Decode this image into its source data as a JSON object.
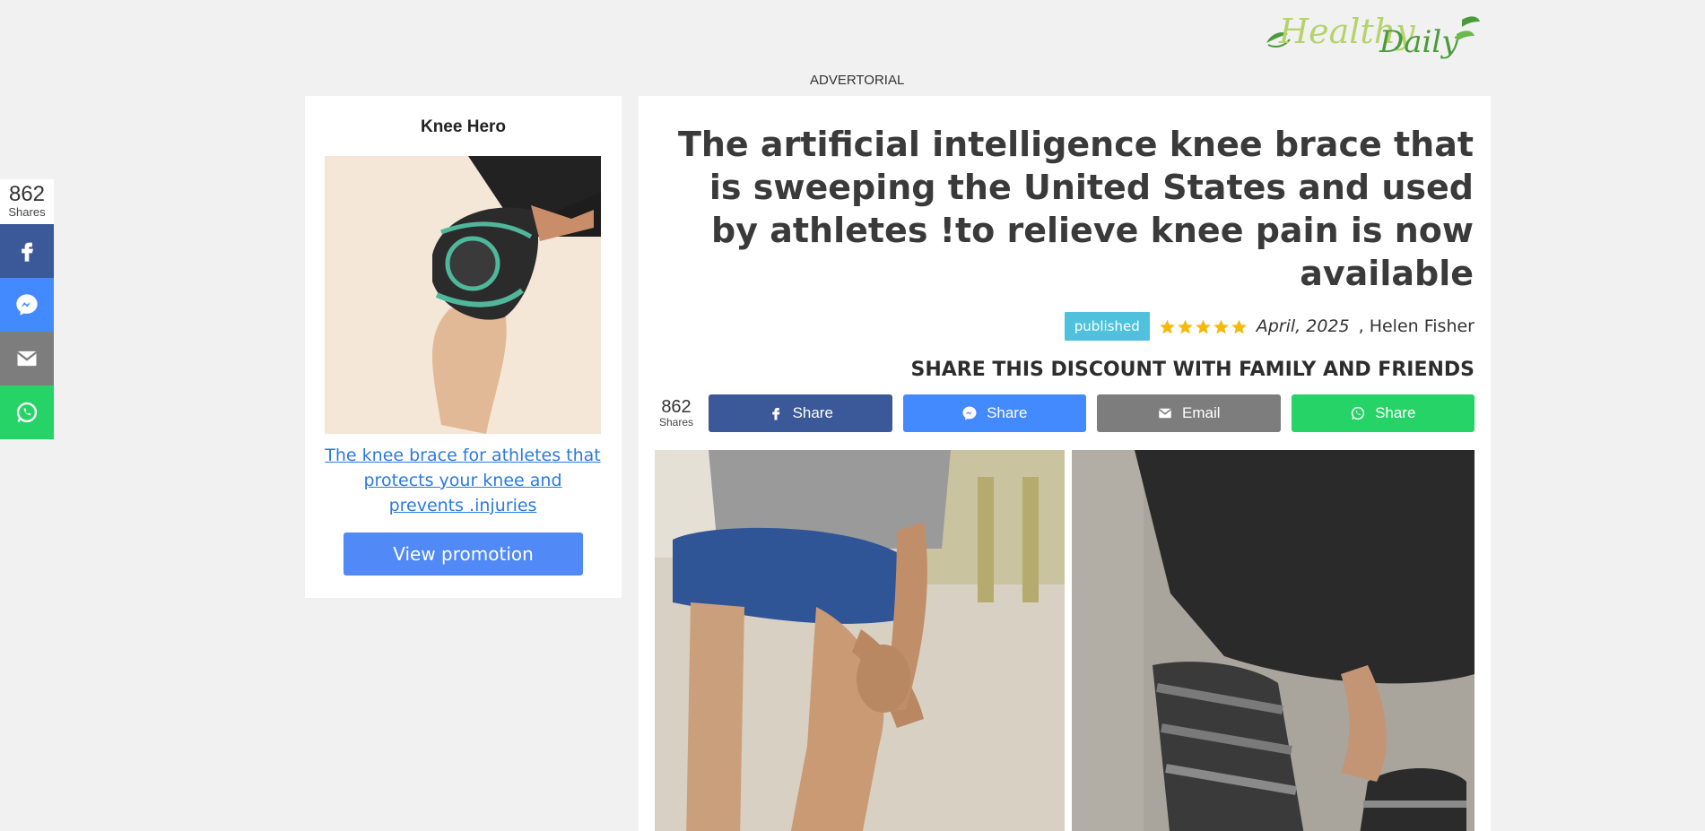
{
  "brand": {
    "logo_text_1": "Healthy",
    "logo_text_2": "Daily",
    "logo_icon": "leaf-icon",
    "color_green_light": "#b5d36b",
    "color_green_dark": "#4a9b3a"
  },
  "advertorial_label": "ADVERTORIAL",
  "float_share": {
    "count": "862",
    "count_label": "Shares",
    "buttons": [
      {
        "icon": "facebook-icon",
        "color": "#3b5998"
      },
      {
        "icon": "messenger-icon",
        "color": "#448aff"
      },
      {
        "icon": "email-icon",
        "color": "#7d7d7d"
      },
      {
        "icon": "whatsapp-icon",
        "color": "#25d366"
      }
    ]
  },
  "sidebar": {
    "title": "Knee Hero",
    "product_image": "knee-brace-product-image",
    "link_text": "The knee brace for athletes that protects your knee and prevents .injuries",
    "button_label": "View promotion"
  },
  "article": {
    "headline": "The artificial intelligence knee brace that is sweeping the United States and used by athletes !to relieve knee pain is now available",
    "badge": "published",
    "rating": 5,
    "date": "April, 2025",
    "author": "Helen Fisher",
    "share_heading": "SHARE THIS DISCOUNT WITH FAMILY AND FRIENDS",
    "share_count": "862",
    "share_count_label": "Shares",
    "share_buttons": [
      {
        "label": "Share",
        "icon": "facebook-icon",
        "color": "#3b5998"
      },
      {
        "label": "Share",
        "icon": "messenger-icon",
        "color": "#448aff"
      },
      {
        "label": "Email",
        "icon": "email-icon",
        "color": "#7d7d7d"
      },
      {
        "label": "Share",
        "icon": "whatsapp-icon",
        "color": "#25d366"
      }
    ],
    "images": [
      "man-holding-knee-photo",
      "knee-brace-worn-photo"
    ]
  },
  "colors": {
    "star": "#f5b90b",
    "badge": "#4fc1dd",
    "promo_button": "#5189f6",
    "link": "#2a7ae2"
  }
}
